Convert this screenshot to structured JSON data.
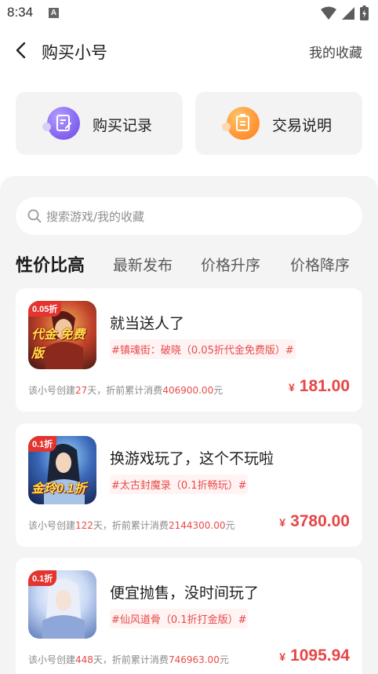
{
  "status": {
    "time": "8:34",
    "notif": "A"
  },
  "nav": {
    "title": "购买小号",
    "right_link": "我的收藏"
  },
  "quick": [
    {
      "label": "购买记录",
      "icon": "document-edit-icon",
      "color": "#7b5cf0"
    },
    {
      "label": "交易说明",
      "icon": "document-copy-icon",
      "color": "#ff8a1f"
    }
  ],
  "search": {
    "placeholder": "搜索游戏/我的收藏"
  },
  "tabs": [
    "性价比高",
    "最新发布",
    "价格升序",
    "价格降序"
  ],
  "listings": [
    {
      "badge": "0.05折",
      "art_text": "代金 免费版",
      "title": "就当送人了",
      "tag": "#镇魂街：破晓（0.05折代金免费版）#",
      "info_prefix": "该小号创建",
      "days": "27",
      "info_mid": "天，折前累计消费",
      "spend": "406900.00",
      "info_suffix": "元",
      "currency": "¥",
      "price": "181.00"
    },
    {
      "badge": "0.1折",
      "art_text": "金玲0.1折",
      "title": "换游戏玩了，这个不玩啦",
      "tag": "#太古封魔录（0.1折畅玩）#",
      "info_prefix": "该小号创建",
      "days": "122",
      "info_mid": "天，折前累计消费",
      "spend": "2144300.00",
      "info_suffix": "元",
      "currency": "¥",
      "price": "3780.00"
    },
    {
      "badge": "0.1折",
      "art_text": "",
      "title": "便宜抛售，没时间玩了",
      "tag": "#仙风道骨（0.1折打金版）#",
      "info_prefix": "该小号创建",
      "days": "448",
      "info_mid": "天，折前累计消费",
      "spend": "746963.00",
      "info_suffix": "元",
      "currency": "¥",
      "price": "1095.94"
    }
  ],
  "colors": {
    "accent": "#e74646",
    "sheet_bg": "#f4f4f4"
  }
}
